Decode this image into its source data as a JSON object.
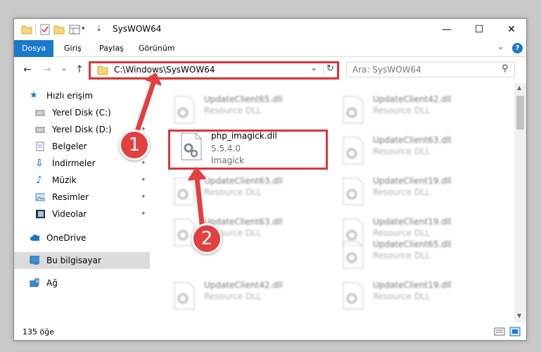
{
  "window": {
    "title": "SysWOW64",
    "minimize_glyph": "—",
    "maximize_glyph": "☐",
    "close_glyph": "✕"
  },
  "ribbon": {
    "tabs": [
      {
        "label": "Dosya",
        "active": true
      },
      {
        "label": "Giriş",
        "active": false
      },
      {
        "label": "Paylaş",
        "active": false
      },
      {
        "label": "Görünüm",
        "active": false
      }
    ],
    "collapse_glyph": "⌄",
    "help_glyph": "?"
  },
  "nav": {
    "back_glyph": "←",
    "forward_glyph": "→",
    "recent_glyph": "⌄",
    "up_glyph": "↑",
    "address": "C:\\Windows\\SysWOW64",
    "address_dropdown_glyph": "⌄",
    "refresh_glyph": "↻",
    "search_placeholder": "Ara: SysWOW64",
    "search_glyph": "⚲"
  },
  "sidebar": {
    "items": [
      {
        "label": "Hızlı erişim",
        "icon": "star-icon",
        "pinned": false,
        "selected": false
      },
      {
        "label": "Yerel Disk (C:)",
        "icon": "drive-icon",
        "pinned": true,
        "selected": false
      },
      {
        "label": "Yerel Disk (D:)",
        "icon": "drive-icon",
        "pinned": true,
        "selected": false
      },
      {
        "label": "Belgeler",
        "icon": "documents-icon",
        "pinned": true,
        "selected": false
      },
      {
        "label": "İndirmeler",
        "icon": "download-icon",
        "pinned": true,
        "selected": false
      },
      {
        "label": "Müzik",
        "icon": "music-icon",
        "pinned": true,
        "selected": false
      },
      {
        "label": "Resimler",
        "icon": "pictures-icon",
        "pinned": true,
        "selected": false
      },
      {
        "label": "Videolar",
        "icon": "videos-icon",
        "pinned": true,
        "selected": false
      },
      {
        "label": "OneDrive",
        "icon": "cloud-icon",
        "pinned": false,
        "selected": false
      },
      {
        "label": "Bu bilgisayar",
        "icon": "computer-icon",
        "pinned": false,
        "selected": true
      },
      {
        "label": "Ağ",
        "icon": "network-icon",
        "pinned": false,
        "selected": false
      }
    ],
    "pin_glyph": "📌"
  },
  "files": {
    "highlighted": {
      "name": "php_imagick.dll",
      "version": "5.5.4.0",
      "description": "Imagick"
    },
    "background": [
      {
        "name": "UpdateClient65.dll",
        "type": "Resource DLL"
      },
      {
        "name": "UpdateClient42.dll",
        "type": "Resource DLL"
      },
      {
        "name": "UpdateClient63.dll",
        "type": "Resource DLL"
      },
      {
        "name": "UpdateClient19.dll",
        "type": "Resource DLL"
      },
      {
        "name": "UpdateClient63.dll",
        "type": "Resource DLL"
      },
      {
        "name": "UpdateClient19.dll",
        "type": "Resource DLL"
      },
      {
        "name": "UpdateClient63.dll",
        "type": "Resource DLL"
      },
      {
        "name": "UpdateClient65.dll",
        "type": "Resource DLL"
      },
      {
        "name": "UpdateClient42.dll",
        "type": "Resource DLL"
      },
      {
        "name": "UpdateClient19.dll",
        "type": "Resource DLL"
      }
    ]
  },
  "status": {
    "count": "135 öğe"
  },
  "annotations": {
    "step1": "1",
    "step2": "2"
  },
  "colors": {
    "accent": "#1979ca",
    "highlight": "#d9363e",
    "badge": "#e24040"
  }
}
